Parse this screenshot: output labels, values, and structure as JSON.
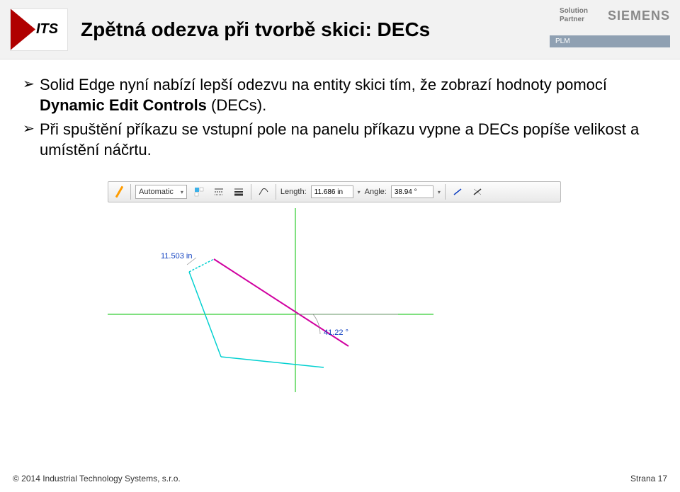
{
  "header": {
    "logo_text": "ITS",
    "title": "Zpětná odezva při tvorbě skici: DECs",
    "partner_line1": "Solution",
    "partner_line2": "Partner",
    "siemens": "SIEMENS",
    "plm": "PLM"
  },
  "bullets": {
    "b1_pre": "Solid Edge nyní nabízí lepší odezvu na entity skici tím, že zobrazí hodnoty pomocí ",
    "b1_strong": "Dynamic Edit Controls",
    "b1_post": " (DECs).",
    "b2": "Při spuštění příkazu se vstupní pole na panelu příkazu vypne a DECs popíše velikost a umístění náčrtu."
  },
  "toolbar": {
    "mode": "Automatic",
    "length_label": "Length:",
    "length_value": "11.686 in",
    "angle_label": "Angle:",
    "angle_value": "38.94 °"
  },
  "sketch": {
    "dim_length": "11.503 in",
    "dim_angle": "41.22 °"
  },
  "footer": {
    "copyright": "© 2014 Industrial Technology Systems, s.r.o.",
    "page": "Strana 17"
  }
}
